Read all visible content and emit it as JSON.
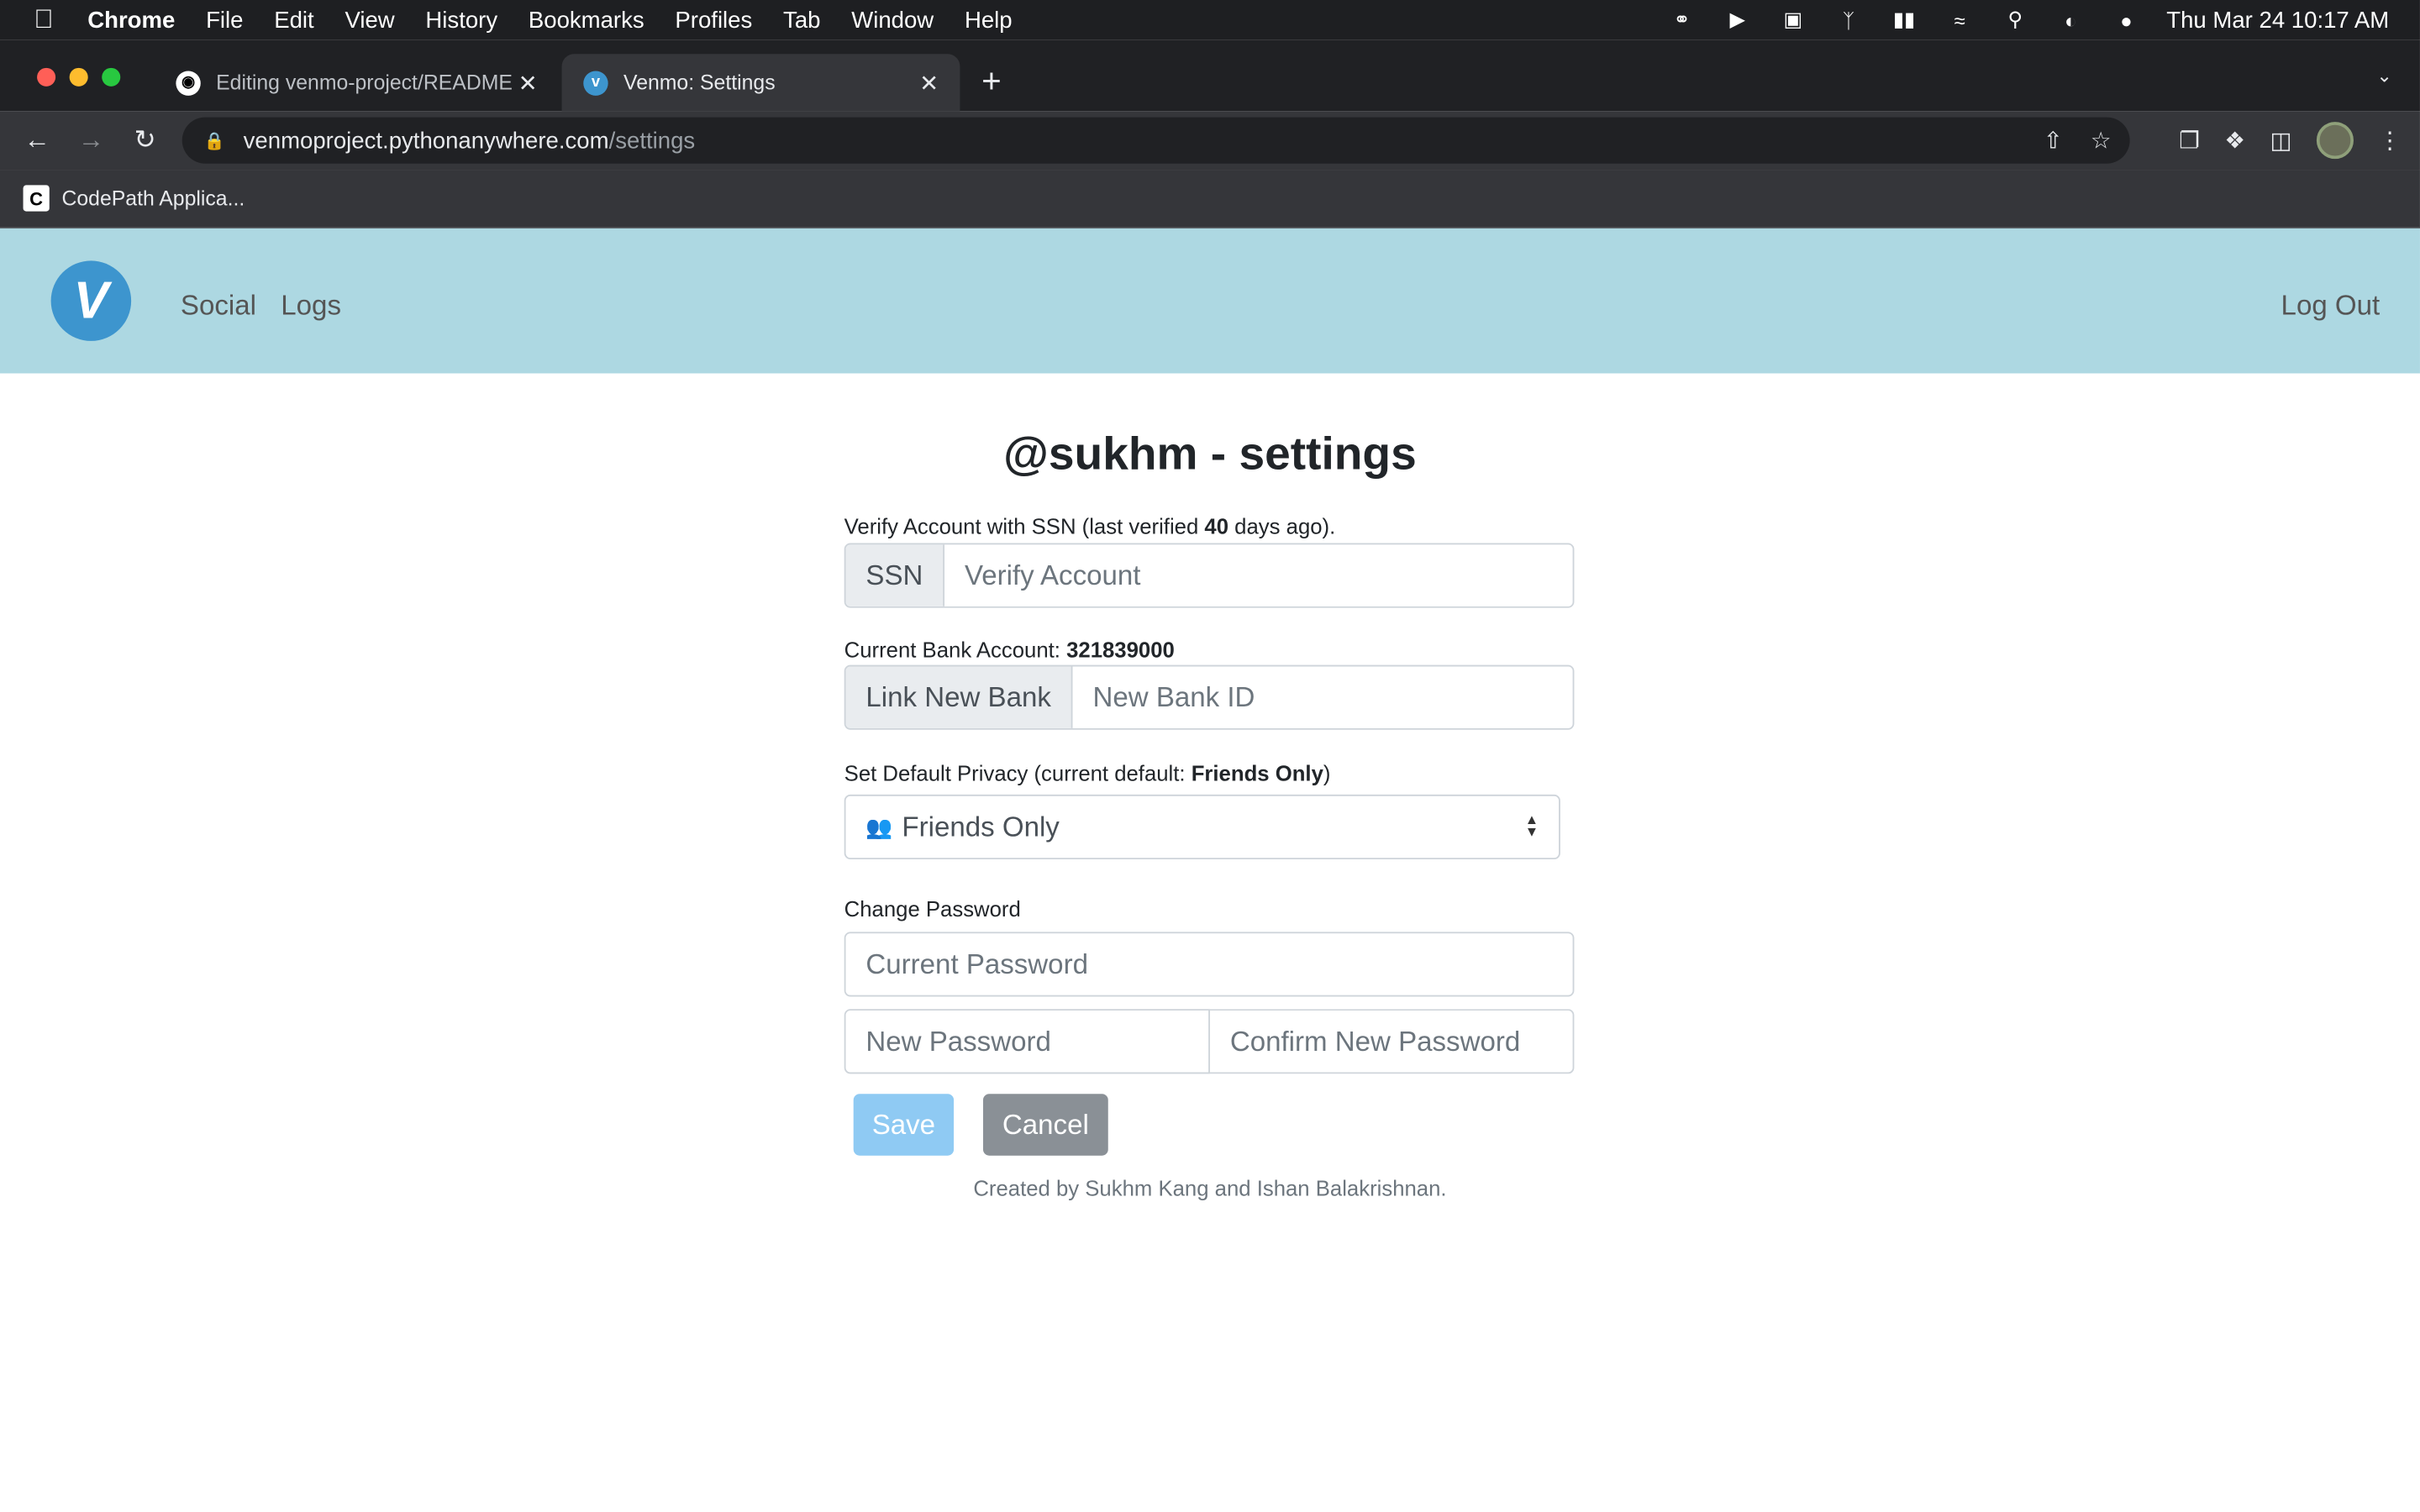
{
  "os_menubar": {
    "app": "Chrome",
    "items": [
      "File",
      "Edit",
      "View",
      "History",
      "Bookmarks",
      "Profiles",
      "Tab",
      "Window",
      "Help"
    ],
    "clock": "Thu Mar 24  10:17 AM"
  },
  "browser": {
    "tabs": [
      {
        "title": "Editing venmo-project/README",
        "icon": "github-icon"
      },
      {
        "title": "Venmo: Settings",
        "icon": "venmo-icon"
      }
    ],
    "url_host": "venmoproject.pythonanywhere.com",
    "url_path": "/settings",
    "bookmark": "CodePath Applica..."
  },
  "site": {
    "logo_letter": "V",
    "nav": {
      "social": "Social",
      "logs": "Logs",
      "logout": "Log Out"
    },
    "brand_color": "#3d95ce",
    "nav_bg": "#add8e2"
  },
  "settings": {
    "title": "@sukhm - settings",
    "ssn": {
      "label_prefix": "Verify Account with SSN (last verified ",
      "days": "40",
      "label_suffix": " days ago).",
      "addon": "SSN",
      "placeholder": "Verify Account"
    },
    "bank": {
      "label_prefix": "Current Bank Account: ",
      "account": "321839000",
      "addon": "Link New Bank",
      "placeholder": "New Bank ID"
    },
    "privacy": {
      "label_prefix": "Set Default Privacy (current default: ",
      "current": "Friends Only",
      "label_suffix": ")",
      "selected_icon": "👥",
      "selected": "Friends Only"
    },
    "password": {
      "label": "Change Password",
      "current_placeholder": "Current Password",
      "new_placeholder": "New Password",
      "confirm_placeholder": "Confirm New Password"
    },
    "save": "Save",
    "cancel": "Cancel",
    "footer": "Created by Sukhm Kang and Ishan Balakrishnan."
  }
}
